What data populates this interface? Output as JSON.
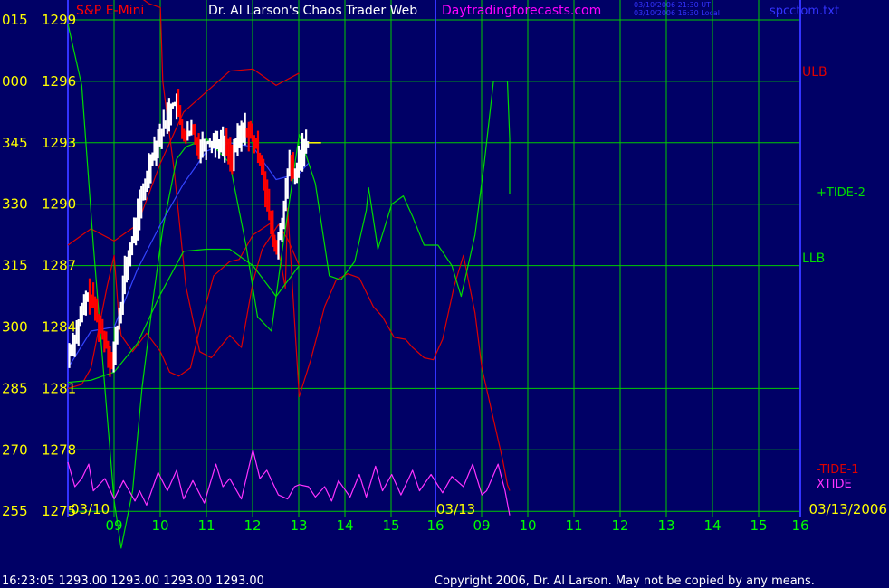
{
  "header": {
    "symbol": "S&P E-Mini",
    "title": "Dr. Al Larson's Chaos Trader Web",
    "site": "Daytradingforecasts.com",
    "stamp_line1": "03/10/2006 21:30 UT",
    "stamp_line2": "03/10/2006 16:30 Local",
    "file": "spcctom.txt"
  },
  "footer": {
    "status": "16:23:05  1293.00 1293.00 1293.00 1293.00",
    "copyright": "Copyright 2006, Dr. Al Larson. May not be copied by any means."
  },
  "colors": {
    "background": "#000066",
    "grid": "#00cc00",
    "axis_border": "#3333ff",
    "price_up": "#ffffff",
    "price_down": "#ff0000",
    "tide_green": "#00dd00",
    "tide_red": "#dd0000",
    "xtide": "#ff33ff",
    "moving_avg": "#3344ff",
    "label_yellow": "#ffff00",
    "label_green": "#00ff00",
    "label_magenta": "#ff00ff"
  },
  "chart_data": {
    "type": "line",
    "y_axis": {
      "angle_labels": [
        "015",
        "000",
        "345",
        "330",
        "315",
        "300",
        "285",
        "270",
        "255"
      ],
      "price_labels": [
        "1299",
        "1296",
        "1293",
        "1290",
        "1287",
        "1284",
        "1281",
        "1278",
        "1275"
      ],
      "ylim": [
        1275,
        1299
      ]
    },
    "x_axis": {
      "hour_labels": [
        "09",
        "10",
        "11",
        "12",
        "13",
        "14",
        "15",
        "16",
        "09",
        "10",
        "11",
        "12",
        "13",
        "14",
        "15",
        "16"
      ],
      "date_labels": [
        "03/10",
        "03/13",
        "03/13/2006"
      ]
    },
    "series_labels": {
      "ulb": "ULB",
      "tide2": "+TIDE-2",
      "llb": "LLB",
      "tide1": "-TIDE-1",
      "xtide": "XTIDE"
    },
    "last_price": 1293.0,
    "price_path": [
      [
        0.0,
        1282.5
      ],
      [
        0.1,
        1283.2
      ],
      [
        0.2,
        1283.8
      ],
      [
        0.3,
        1284.6
      ],
      [
        0.45,
        1285.6
      ],
      [
        0.55,
        1285.2
      ],
      [
        0.7,
        1284.0
      ],
      [
        0.85,
        1283.2
      ],
      [
        0.95,
        1282.0
      ],
      [
        1.05,
        1283.5
      ],
      [
        1.15,
        1285.0
      ],
      [
        1.25,
        1286.8
      ],
      [
        1.35,
        1287.6
      ],
      [
        1.45,
        1288.8
      ],
      [
        1.55,
        1289.8
      ],
      [
        1.65,
        1290.6
      ],
      [
        1.75,
        1291.8
      ],
      [
        1.85,
        1292.6
      ],
      [
        1.95,
        1293.2
      ],
      [
        2.05,
        1293.6
      ],
      [
        2.2,
        1294.6
      ],
      [
        2.35,
        1295.0
      ],
      [
        2.45,
        1293.8
      ],
      [
        2.55,
        1293.2
      ],
      [
        2.7,
        1293.6
      ],
      [
        2.85,
        1292.8
      ],
      [
        3.0,
        1293.0
      ],
      [
        3.2,
        1293.1
      ],
      [
        3.4,
        1292.9
      ],
      [
        3.55,
        1292.3
      ],
      [
        3.7,
        1293.2
      ],
      [
        3.85,
        1293.7
      ],
      [
        4.0,
        1293.2
      ],
      [
        4.2,
        1292.0
      ],
      [
        4.35,
        1289.5
      ],
      [
        4.45,
        1288.3
      ],
      [
        4.5,
        1287.5
      ],
      [
        4.6,
        1288.8
      ],
      [
        4.7,
        1290.0
      ],
      [
        4.8,
        1292.3
      ],
      [
        4.9,
        1291.0
      ],
      [
        5.0,
        1292.2
      ],
      [
        5.1,
        1292.8
      ],
      [
        5.2,
        1293.0
      ]
    ],
    "moving_avg": [
      [
        0.0,
        1282.0
      ],
      [
        0.5,
        1283.8
      ],
      [
        1.0,
        1284.0
      ],
      [
        1.5,
        1286.8
      ],
      [
        2.0,
        1289.0
      ],
      [
        2.5,
        1291.0
      ],
      [
        3.0,
        1292.6
      ],
      [
        3.5,
        1293.0
      ],
      [
        4.0,
        1292.8
      ],
      [
        4.5,
        1291.2
      ],
      [
        5.0,
        1291.5
      ],
      [
        5.2,
        1292.0
      ]
    ],
    "tide2_green": [
      [
        0.0,
        1298.8
      ],
      [
        0.3,
        1295.8
      ],
      [
        0.55,
        1288.0
      ],
      [
        0.8,
        1281.0
      ],
      [
        1.0,
        1275.5
      ],
      [
        1.15,
        1273.2
      ],
      [
        1.4,
        1276.0
      ],
      [
        1.6,
        1281.0
      ],
      [
        1.85,
        1285.5
      ],
      [
        2.05,
        1288.8
      ],
      [
        2.35,
        1292.2
      ],
      [
        2.55,
        1292.8
      ],
      [
        3.0,
        1293.2
      ],
      [
        3.5,
        1292.0
      ],
      [
        3.85,
        1288.0
      ],
      [
        4.1,
        1284.5
      ],
      [
        4.4,
        1283.8
      ],
      [
        4.65,
        1288.0
      ],
      [
        5.0,
        1293.4
      ],
      [
        5.35,
        1291.0
      ],
      [
        5.65,
        1286.5
      ],
      [
        5.9,
        1286.3
      ],
      [
        6.2,
        1287.2
      ],
      [
        6.45,
        1289.7
      ],
      [
        6.5,
        1290.8
      ],
      [
        6.7,
        1287.8
      ],
      [
        7.0,
        1290.0
      ],
      [
        7.25,
        1290.4
      ],
      [
        7.45,
        1289.4
      ],
      [
        7.7,
        1288.0
      ],
      [
        8.0,
        1288.0
      ],
      [
        8.3,
        1287.0
      ],
      [
        8.5,
        1285.5
      ],
      [
        8.8,
        1288.5
      ],
      [
        9.0,
        1292.0
      ],
      [
        9.2,
        1296.0
      ],
      [
        9.5,
        1296.0
      ],
      [
        9.55,
        1293.2
      ],
      [
        9.55,
        1290.5
      ]
    ],
    "llb_green": [
      [
        0.0,
        1281.3
      ],
      [
        0.5,
        1281.4
      ],
      [
        1.0,
        1281.8
      ],
      [
        1.5,
        1283.2
      ],
      [
        2.0,
        1285.6
      ],
      [
        2.5,
        1287.7
      ],
      [
        3.0,
        1287.8
      ],
      [
        3.5,
        1287.8
      ],
      [
        4.0,
        1287.0
      ],
      [
        4.5,
        1285.5
      ],
      [
        5.0,
        1287.0
      ]
    ],
    "ulb_red": [
      [
        0.0,
        1288.0
      ],
      [
        0.5,
        1288.8
      ],
      [
        1.0,
        1288.2
      ],
      [
        1.5,
        1289.0
      ],
      [
        2.0,
        1292.0
      ],
      [
        2.5,
        1294.5
      ],
      [
        3.0,
        1295.5
      ],
      [
        3.5,
        1296.5
      ],
      [
        4.0,
        1296.6
      ],
      [
        4.5,
        1295.8
      ],
      [
        5.0,
        1296.4
      ]
    ],
    "red_bow": [
      [
        1.5,
        1300.2
      ],
      [
        1.75,
        1299.8
      ],
      [
        2.0,
        1299.6
      ],
      [
        2.05,
        1296.0
      ],
      [
        2.3,
        1291.6
      ],
      [
        2.55,
        1286.0
      ],
      [
        2.85,
        1282.8
      ],
      [
        3.1,
        1282.5
      ],
      [
        3.5,
        1283.6
      ],
      [
        3.75,
        1283.0
      ],
      [
        4.0,
        1286.2
      ],
      [
        4.2,
        1287.8
      ],
      [
        4.55,
        1289.0
      ],
      [
        4.75,
        1288.3
      ],
      [
        5.0,
        1287.0
      ]
    ],
    "tide1_red": [
      [
        0.0,
        1281.0
      ],
      [
        0.3,
        1281.2
      ],
      [
        0.5,
        1282.0
      ],
      [
        0.85,
        1286.0
      ],
      [
        1.0,
        1287.5
      ],
      [
        1.1,
        1284.5
      ],
      [
        1.15,
        1283.6
      ],
      [
        1.4,
        1282.8
      ],
      [
        1.7,
        1283.7
      ],
      [
        2.0,
        1282.8
      ],
      [
        2.2,
        1281.8
      ],
      [
        2.4,
        1281.6
      ],
      [
        2.65,
        1282.0
      ],
      [
        2.9,
        1284.4
      ],
      [
        3.15,
        1286.5
      ],
      [
        3.5,
        1287.2
      ],
      [
        3.7,
        1287.3
      ],
      [
        4.0,
        1288.5
      ],
      [
        4.2,
        1288.8
      ],
      [
        4.4,
        1289.1
      ],
      [
        4.6,
        1287.2
      ],
      [
        4.7,
        1285.9
      ],
      [
        4.75,
        1289.8
      ],
      [
        5.0,
        1280.6
      ],
      [
        5.25,
        1282.4
      ],
      [
        5.55,
        1285.0
      ],
      [
        5.8,
        1286.3
      ],
      [
        6.05,
        1286.6
      ],
      [
        6.3,
        1286.4
      ],
      [
        6.6,
        1285.0
      ],
      [
        6.8,
        1284.5
      ],
      [
        7.05,
        1283.5
      ],
      [
        7.3,
        1283.4
      ],
      [
        7.45,
        1283.0
      ],
      [
        7.7,
        1282.5
      ],
      [
        7.9,
        1282.4
      ],
      [
        8.1,
        1283.4
      ],
      [
        8.35,
        1286.0
      ],
      [
        8.55,
        1287.5
      ],
      [
        8.7,
        1285.8
      ],
      [
        8.8,
        1284.7
      ],
      [
        8.95,
        1282.0
      ],
      [
        9.2,
        1279.5
      ],
      [
        9.4,
        1277.5
      ],
      [
        9.5,
        1276.3
      ],
      [
        9.55,
        1276.0
      ]
    ],
    "xtide": [
      [
        0.0,
        1277.4
      ],
      [
        0.15,
        1276.2
      ],
      [
        0.3,
        1276.6
      ],
      [
        0.45,
        1277.3
      ],
      [
        0.55,
        1276.0
      ],
      [
        0.8,
        1276.6
      ],
      [
        1.0,
        1275.6
      ],
      [
        1.2,
        1276.5
      ],
      [
        1.45,
        1275.5
      ],
      [
        1.55,
        1276.0
      ],
      [
        1.7,
        1275.3
      ],
      [
        1.95,
        1276.9
      ],
      [
        2.15,
        1276.0
      ],
      [
        2.35,
        1277.0
      ],
      [
        2.5,
        1275.6
      ],
      [
        2.7,
        1276.5
      ],
      [
        2.95,
        1275.4
      ],
      [
        3.2,
        1277.3
      ],
      [
        3.35,
        1276.2
      ],
      [
        3.5,
        1276.6
      ],
      [
        3.75,
        1275.6
      ],
      [
        4.0,
        1278.0
      ],
      [
        4.15,
        1276.6
      ],
      [
        4.3,
        1277.0
      ],
      [
        4.55,
        1275.8
      ],
      [
        4.75,
        1275.6
      ],
      [
        4.9,
        1276.2
      ],
      [
        5.0,
        1276.3
      ],
      [
        5.2,
        1276.2
      ],
      [
        5.35,
        1275.7
      ],
      [
        5.55,
        1276.2
      ],
      [
        5.7,
        1275.5
      ],
      [
        5.85,
        1276.5
      ],
      [
        6.1,
        1275.7
      ],
      [
        6.3,
        1276.8
      ],
      [
        6.45,
        1275.7
      ],
      [
        6.65,
        1277.2
      ],
      [
        6.8,
        1276.0
      ],
      [
        7.0,
        1276.8
      ],
      [
        7.2,
        1275.8
      ],
      [
        7.45,
        1277.0
      ],
      [
        7.6,
        1276.0
      ],
      [
        7.85,
        1276.8
      ],
      [
        8.1,
        1275.9
      ],
      [
        8.3,
        1276.7
      ],
      [
        8.55,
        1276.2
      ],
      [
        8.75,
        1277.3
      ],
      [
        8.95,
        1275.8
      ],
      [
        9.05,
        1276.0
      ],
      [
        9.3,
        1277.3
      ],
      [
        9.45,
        1276.0
      ],
      [
        9.55,
        1274.8
      ]
    ]
  }
}
